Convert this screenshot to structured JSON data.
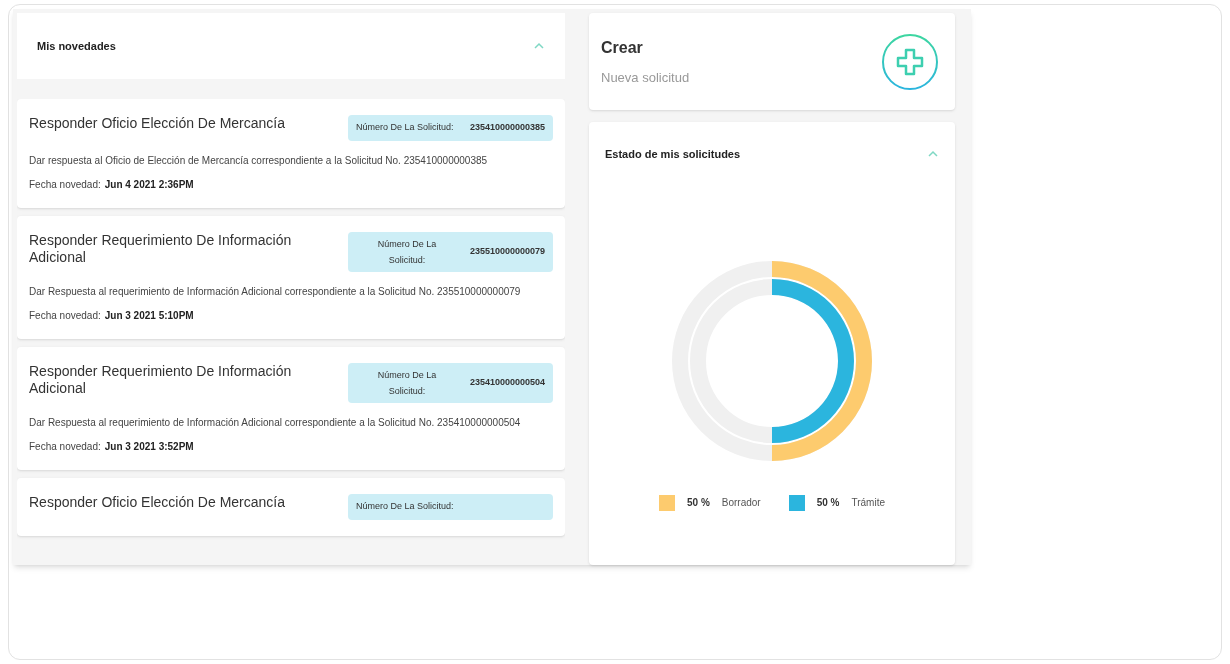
{
  "novedades": {
    "title": "Mis novedades",
    "expanded": true,
    "items": [
      {
        "title": "Responder Oficio Elección De Mercancía",
        "badge_label": "Número De La Solicitud:",
        "badge_number": "235410000000385",
        "description": "Dar respuesta al Oficio de Elección de Mercancía correspondiente a la Solicitud No. 235410000000385",
        "date_label": "Fecha novedad:",
        "date": "Jun 4 2021 2:36PM"
      },
      {
        "title": "Responder Requerimiento De Información Adicional",
        "badge_label": "Número De La Solicitud:",
        "badge_number": "235510000000079",
        "description": "Dar Respuesta al requerimiento de Información Adicional correspondiente a la Solicitud No. 235510000000079",
        "date_label": "Fecha novedad:",
        "date": "Jun 3 2021 5:10PM"
      },
      {
        "title": "Responder Requerimiento De Información Adicional",
        "badge_label": "Número De La Solicitud:",
        "badge_number": "235410000000504",
        "description": "Dar Respuesta al requerimiento de Información Adicional correspondiente a la Solicitud No. 235410000000504",
        "date_label": "Fecha novedad:",
        "date": "Jun 3 2021 3:52PM"
      },
      {
        "title": "Responder Oficio Elección De Mercancía",
        "badge_label": "Número De La Solicitud:"
      }
    ]
  },
  "crear": {
    "title": "Crear",
    "subtitle": "Nueva solicitud"
  },
  "estado": {
    "title": "Estado de mis solicitudes",
    "expanded": true,
    "rings": [
      {
        "percent": "50 %",
        "label": "Borrador",
        "color": "#fdcb6e"
      },
      {
        "percent": "50 %",
        "label": "Trámite",
        "color": "#2bb5de"
      }
    ]
  }
}
